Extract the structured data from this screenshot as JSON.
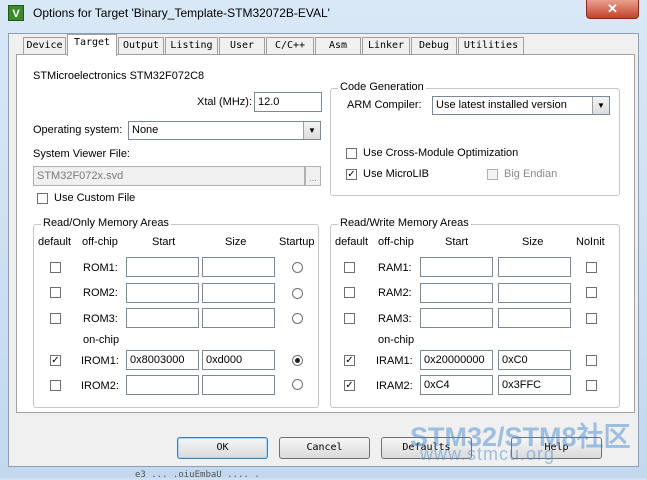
{
  "window": {
    "title": "Options for Target 'Binary_Template-STM32072B-EVAL'",
    "app_icon": "keil-uv-icon",
    "close_glyph": "✕"
  },
  "tabs": [
    {
      "label": "Device",
      "active": false
    },
    {
      "label": "Target",
      "active": true
    },
    {
      "label": "Output",
      "active": false
    },
    {
      "label": "Listing",
      "active": false
    },
    {
      "label": "User",
      "active": false
    },
    {
      "label": "C/C++",
      "active": false
    },
    {
      "label": "Asm",
      "active": false
    },
    {
      "label": "Linker",
      "active": false
    },
    {
      "label": "Debug",
      "active": false
    },
    {
      "label": "Utilities",
      "active": false
    }
  ],
  "target": {
    "device_name": "STMicroelectronics STM32F072C8",
    "xtal_label": "Xtal (MHz):",
    "xtal_value": "12.0",
    "os_label": "Operating system:",
    "os_value": "None",
    "svd_label": "System Viewer File:",
    "svd_value": "STM32F072x.svd",
    "browse_label": "...",
    "custom_file_label": "Use Custom File",
    "custom_file_checked": false
  },
  "codegen": {
    "title": "Code Generation",
    "compiler_label": "ARM Compiler:",
    "compiler_value": "Use latest installed version",
    "cross_module_label": "Use Cross-Module Optimization",
    "cross_module_checked": false,
    "microlib_label": "Use MicroLIB",
    "microlib_checked": true,
    "big_endian_label": "Big Endian",
    "big_endian_checked": false
  },
  "ro_memory": {
    "title": "Read/Only Memory Areas",
    "headers": {
      "default": "default",
      "offchip": "off-chip",
      "start": "Start",
      "size": "Size",
      "startup": "Startup"
    },
    "onchip_label": "on-chip",
    "rows": [
      {
        "name": "ROM1:",
        "default": false,
        "start": "",
        "size": "",
        "startup": false
      },
      {
        "name": "ROM2:",
        "default": false,
        "start": "",
        "size": "",
        "startup": false
      },
      {
        "name": "ROM3:",
        "default": false,
        "start": "",
        "size": "",
        "startup": false
      },
      {
        "name": "IROM1:",
        "default": true,
        "start": "0x8003000",
        "size": "0xd000",
        "startup": true
      },
      {
        "name": "IROM2:",
        "default": false,
        "start": "",
        "size": "",
        "startup": false
      }
    ]
  },
  "rw_memory": {
    "title": "Read/Write Memory Areas",
    "headers": {
      "default": "default",
      "offchip": "off-chip",
      "start": "Start",
      "size": "Size",
      "noinit": "NoInit"
    },
    "onchip_label": "on-chip",
    "rows": [
      {
        "name": "RAM1:",
        "default": false,
        "start": "",
        "size": "",
        "noinit": false
      },
      {
        "name": "RAM2:",
        "default": false,
        "start": "",
        "size": "",
        "noinit": false
      },
      {
        "name": "RAM3:",
        "default": false,
        "start": "",
        "size": "",
        "noinit": false
      },
      {
        "name": "IRAM1:",
        "default": true,
        "start": "0x20000000",
        "size": "0xC0",
        "noinit": false
      },
      {
        "name": "IRAM2:",
        "default": true,
        "start": "0xC4",
        "size": "0x3FFC",
        "noinit": false
      }
    ]
  },
  "buttons": {
    "ok": "OK",
    "cancel": "Cancel",
    "defaults": "Defaults",
    "help": "Help"
  },
  "watermark": {
    "brand": "STM32/STM8社区",
    "url": "www.stmcu.org"
  },
  "background_code": "e3 ... .oiuEmbaU  .... ."
}
